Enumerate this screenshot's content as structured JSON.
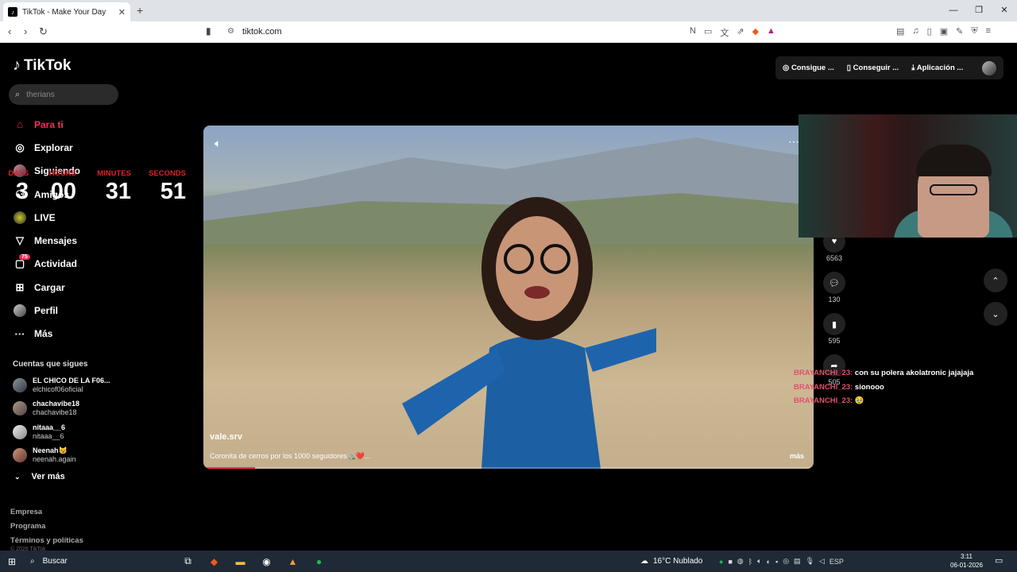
{
  "browser": {
    "tab_title": "TikTok - Make Your Day",
    "tab_favicon": "tiktok-icon",
    "url": "tiktok.com",
    "new_tab_symbol": "+",
    "close_symbol": "✕"
  },
  "sidebar": {
    "logo": "TikTok",
    "search_placeholder": "therians",
    "nav": [
      {
        "label": "Para ti",
        "icon": "home-icon"
      },
      {
        "label": "Explorar",
        "icon": "compass-icon"
      },
      {
        "label": "Siguiendo",
        "icon": "avatar"
      },
      {
        "label": "Amigos",
        "icon": "friends-icon"
      },
      {
        "label": "LIVE",
        "icon": "live-icon"
      },
      {
        "label": "Mensajes",
        "icon": "send-icon"
      },
      {
        "label": "Actividad",
        "icon": "activity-icon",
        "badge": "75"
      },
      {
        "label": "Cargar",
        "icon": "upload-icon"
      },
      {
        "label": "Perfil",
        "icon": "profile-avatar"
      },
      {
        "label": "Más",
        "icon": "more-icon"
      }
    ],
    "following_title": "Cuentas que sigues",
    "following": [
      {
        "name": "EL CHICO DE LA F06...",
        "handle": "elchicof06oficial"
      },
      {
        "name": "chachavibe18",
        "handle": "chachavibe18"
      },
      {
        "name": "nitaaa__6",
        "handle": "nitaaa__6"
      },
      {
        "name": "Neenah😼",
        "handle": "neenah.again"
      }
    ],
    "see_more": "Ver más",
    "footer": [
      "Empresa",
      "Programa",
      "Términos y políticas"
    ],
    "copyright": "© 2026 TikTok"
  },
  "timer": {
    "labels": {
      "days": "DAYS",
      "hours": "HOURS",
      "minutes": "MINUTES",
      "seconds": "SECONDS"
    },
    "hours": "3",
    "minutes_block": "00",
    "minutes": "31",
    "seconds": "51"
  },
  "topbar": {
    "coins": "Consigue ...",
    "get_app": "Conseguir ...",
    "download": "Aplicación ..."
  },
  "video": {
    "author": "vale.srv",
    "caption": "Coronita de cerros por los 1000 seguidores⛰️❤️...",
    "more": "más",
    "progress": 0.085
  },
  "actions": {
    "likes": "6563",
    "comments": "130",
    "saves": "595",
    "shares": "505"
  },
  "chat": [
    {
      "user": "BRAYANCHI_23:",
      "msg": "con su polera akolatronic jajajaja"
    },
    {
      "user": "BRAYANCHI_23:",
      "msg": "sionooo"
    },
    {
      "user": "BRAYANCHI_23:",
      "msg": "🥹"
    }
  ],
  "taskbar": {
    "search": "Buscar",
    "weather": "16°C  Nublado",
    "lang": "ESP",
    "time": "3:11",
    "date": "06-01-2026"
  }
}
